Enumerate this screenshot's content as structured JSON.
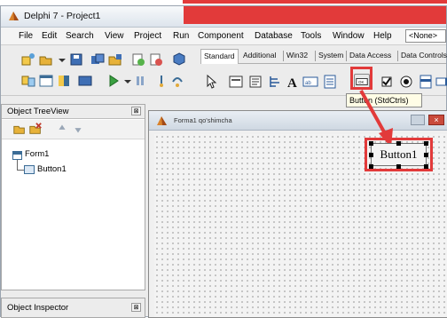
{
  "window": {
    "title": "Delphi 7 - Project1"
  },
  "menu": {
    "items": [
      "File",
      "Edit",
      "Search",
      "View",
      "Project",
      "Run",
      "Component",
      "Database",
      "Tools",
      "Window",
      "Help"
    ],
    "combo_value": "<None>"
  },
  "palette": {
    "tabs": [
      "Standard",
      "Additional",
      "Win32",
      "System",
      "Data Access",
      "Data Controls"
    ],
    "active_tab": "Standard"
  },
  "tooltip": {
    "text": "Button (StdCtrls)"
  },
  "treeview": {
    "title": "Object TreeView",
    "close_glyph": "⊠",
    "nodes": [
      "Form1",
      "Button1"
    ]
  },
  "inspector": {
    "title": "Object Inspector",
    "close_glyph": "⊠"
  },
  "form": {
    "caption": "Forma1 qo'shimcha",
    "button_caption": "Button1"
  },
  "colors": {
    "highlight": "#e23a3a",
    "tooltip_bg": "#fffde6"
  }
}
